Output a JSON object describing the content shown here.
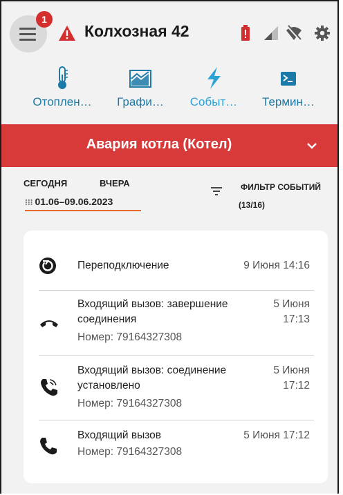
{
  "header": {
    "notification_count": "1",
    "title": "Колхозная 42",
    "status_icons": [
      "battery-alert-icon",
      "signal-icon",
      "wifi-off-icon",
      "gear-icon"
    ],
    "colors": {
      "alert": "#d32f2f",
      "tab_text": "#1c7aa8",
      "alarm_bar": "#d83a3a",
      "accent_underline": "#e86a2a"
    }
  },
  "tabs": [
    {
      "label": "Отоплен…",
      "icon": "thermometer-icon"
    },
    {
      "label": "Графи…",
      "icon": "chart-icon"
    },
    {
      "label": "Событ…",
      "icon": "lightning-icon"
    },
    {
      "label": "Термин…",
      "icon": "terminal-icon"
    }
  ],
  "alarm": {
    "text": "Авария котла (Котел)"
  },
  "filters": {
    "today": "СЕГОДНЯ",
    "yesterday": "ВЧЕРА",
    "range": "01.06–09.06.2023",
    "filter_label": "ФИЛЬТР СОБЫТИЙ",
    "filter_count": "(13/16)"
  },
  "events": [
    {
      "icon": "reconnect-icon",
      "title": "Переподключение",
      "subtitle": "",
      "time": "9 Июня 14:16"
    },
    {
      "icon": "call-end-icon",
      "title": "Входящий вызов: завершение соединения",
      "subtitle": "Номер: 79164327308",
      "time": "5 Июня 17:13"
    },
    {
      "icon": "call-connected-icon",
      "title": "Входящий вызов: соединение установлено",
      "subtitle": "Номер: 79164327308",
      "time": "5 Июня 17:12"
    },
    {
      "icon": "phone-icon",
      "title": "Входящий вызов",
      "subtitle": "Номер: 79164327308",
      "time": "5 Июня 17:12"
    }
  ]
}
